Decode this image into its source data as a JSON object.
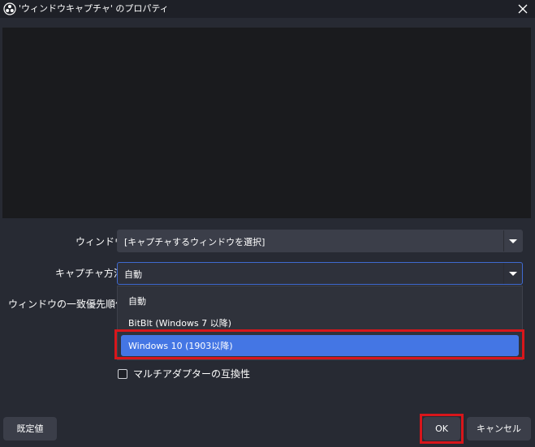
{
  "window": {
    "title": "'ウィンドウキャプチャ' のプロパティ"
  },
  "form": {
    "window_label": "ウィンドウ",
    "window_value": "[キャプチャするウィンドウを選択]",
    "capture_method_label": "キャプチャ方法",
    "capture_method_value": "自動",
    "match_priority_label": "ウィンドウの一致優先順位",
    "capture_method_options": [
      {
        "label": "自動"
      },
      {
        "label": "BitBlt (Windows 7 以降)"
      },
      {
        "label": "Windows 10 (1903以降)"
      }
    ],
    "multi_adapter_label": "マルチアダプターの互換性"
  },
  "buttons": {
    "defaults": "既定値",
    "ok": "OK",
    "cancel": "キャンセル"
  },
  "colors": {
    "background": "#272a33",
    "selection": "#4476e4",
    "annotation_highlight": "#d8161b"
  }
}
